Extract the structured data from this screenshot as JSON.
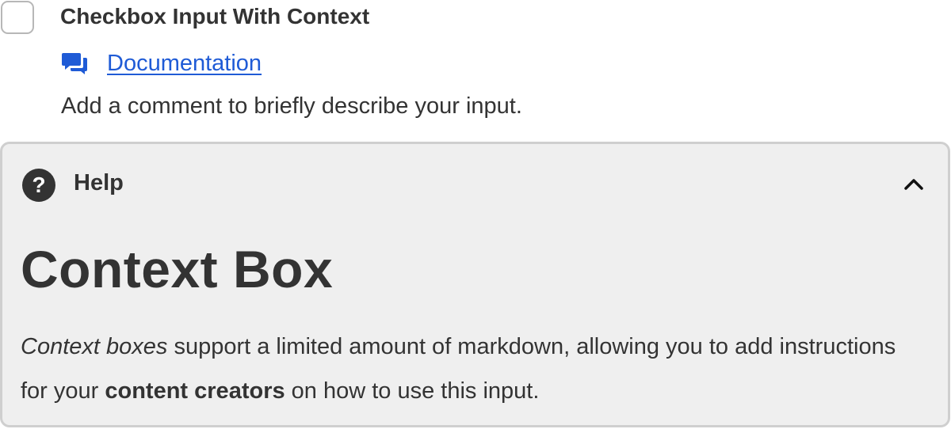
{
  "field": {
    "title": "Checkbox Input With Context",
    "documentation_label": "Documentation",
    "description": "Add a comment to briefly describe your input."
  },
  "help": {
    "label": "Help",
    "icon_glyph": "?",
    "context_title": "Context Box",
    "body": {
      "emphasis": "Context boxes",
      "part1": " support a limited amount of markdown, allowing you to add instructions for your ",
      "strong": "content creators",
      "part2": " on how to use this input."
    }
  },
  "icons": {
    "documentation": "comments-icon",
    "help": "question-circle-icon",
    "toggle": "chevron-up-icon"
  },
  "colors": {
    "link": "#1f5bd6",
    "text": "#333333",
    "help_background": "#efefef",
    "help_border": "#cfcfcf",
    "checkbox_border": "#b7b7b7"
  }
}
